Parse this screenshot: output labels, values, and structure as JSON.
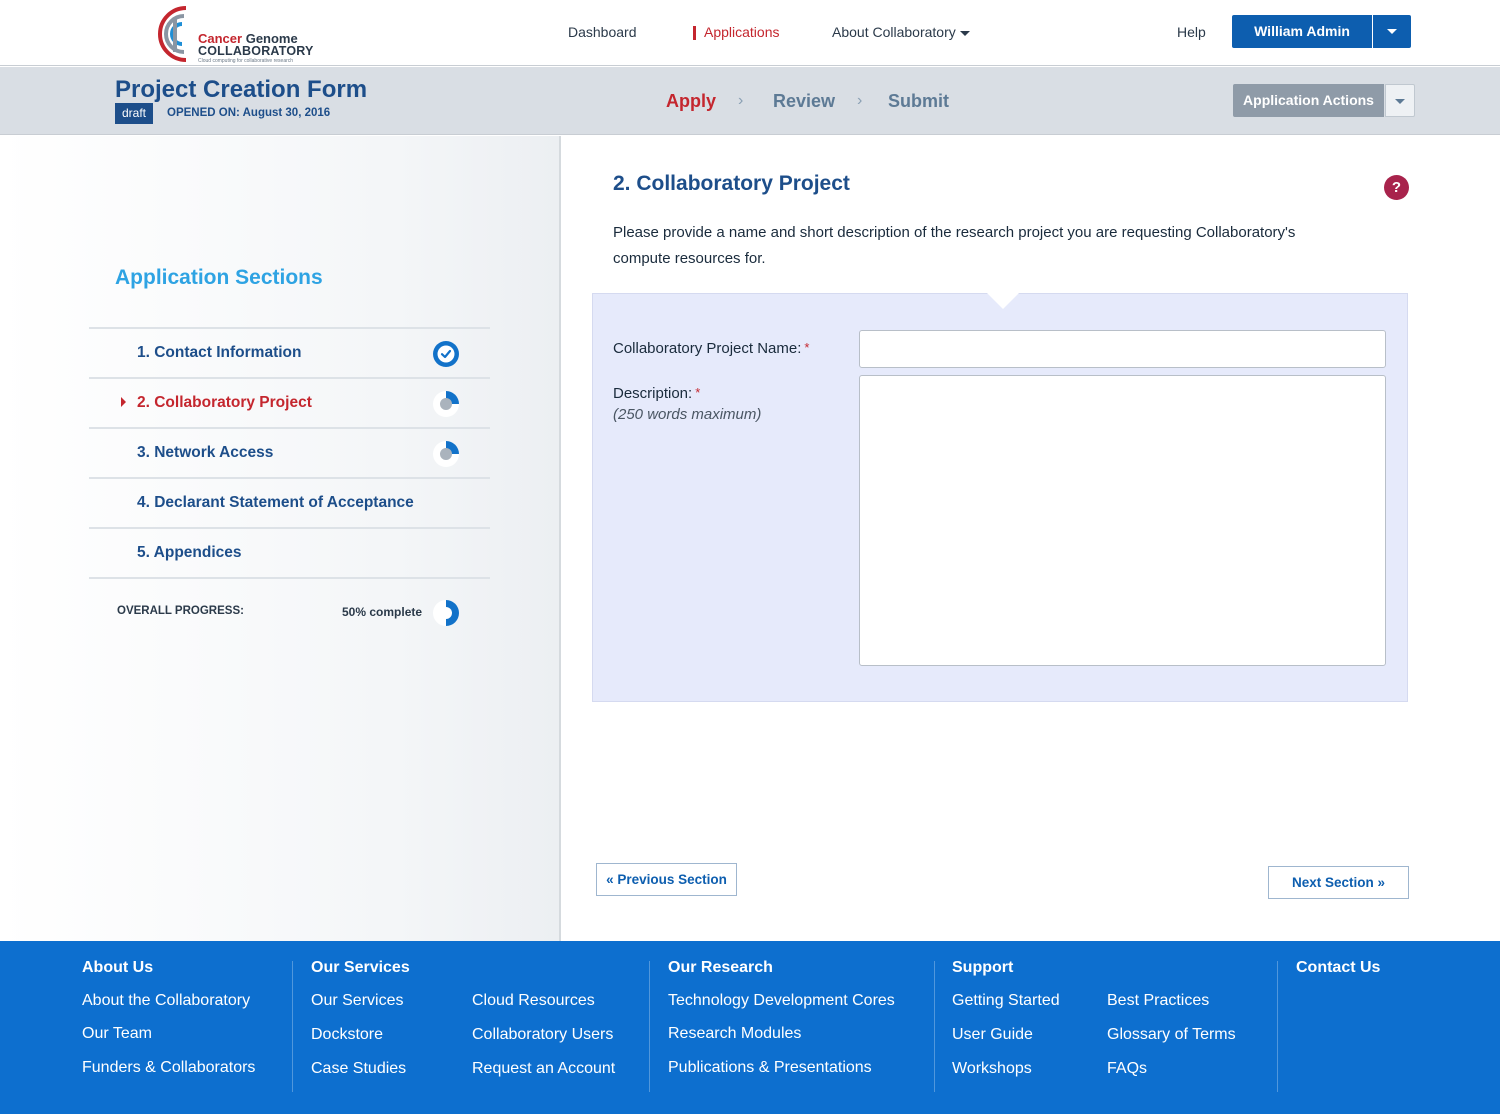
{
  "brand": {
    "name_part1": "Cancer",
    "name_part2": "Genome",
    "name_line2": "COLLABORATORY",
    "tagline": "Cloud computing for collaborative research",
    "red": "#c4262e",
    "blue": "#0d5eaf"
  },
  "nav": {
    "dashboard": "Dashboard",
    "applications": "Applications",
    "about": "About Collaboratory",
    "help": "Help",
    "user": "William Admin"
  },
  "subheader": {
    "title": "Project Creation Form",
    "badge": "draft",
    "opened_on": "OPENED ON: August 30, 2016",
    "steps": [
      "Apply",
      "Review",
      "Submit"
    ],
    "actions": "Application Actions"
  },
  "sidebar": {
    "title": "Application Sections",
    "items": [
      {
        "label": "1.  Contact Information",
        "status": "complete"
      },
      {
        "label": "2.  Collaboratory Project",
        "status": "partial"
      },
      {
        "label": "3.  Network Access",
        "status": "partial"
      },
      {
        "label": "4. Declarant Statement of Acceptance",
        "status": "none"
      },
      {
        "label": "5. Appendices",
        "status": "none"
      }
    ],
    "overall_label": "OVERALL PROGRESS:",
    "overall_value": "50% complete",
    "overall_progress": 0.5
  },
  "main": {
    "heading": "2. Collaboratory Project",
    "help": "?",
    "intro": "Please provide a name and short description of the research project you are requesting Collaboratory's compute resources for.",
    "project_name_label": "Collaboratory Project Name:",
    "project_name_value": "",
    "description_label": "Description:",
    "description_hint": "(250 words maximum)",
    "description_value": "",
    "required_mark": "*",
    "prev": "« Previous Section",
    "next": "Next Section »"
  },
  "footer": {
    "about": {
      "title": "About Us",
      "links": [
        "About the Collaboratory",
        "Our Team",
        "Funders & Collaborators"
      ]
    },
    "services": {
      "title": "Our Services",
      "links": [
        "Our Services",
        "Dockstore",
        "Case Studies",
        "Cloud Resources",
        "Collaboratory Users",
        "Request an Account"
      ]
    },
    "research": {
      "title": "Our Research",
      "links": [
        "Technology Development Cores",
        "Research Modules",
        "Publications & Presentations"
      ]
    },
    "support": {
      "title": "Support",
      "links": [
        "Getting Started",
        "User Guide",
        "Workshops",
        "Best Practices",
        "Glossary of Terms",
        "FAQs"
      ]
    },
    "contact": {
      "title": "Contact Us"
    }
  }
}
